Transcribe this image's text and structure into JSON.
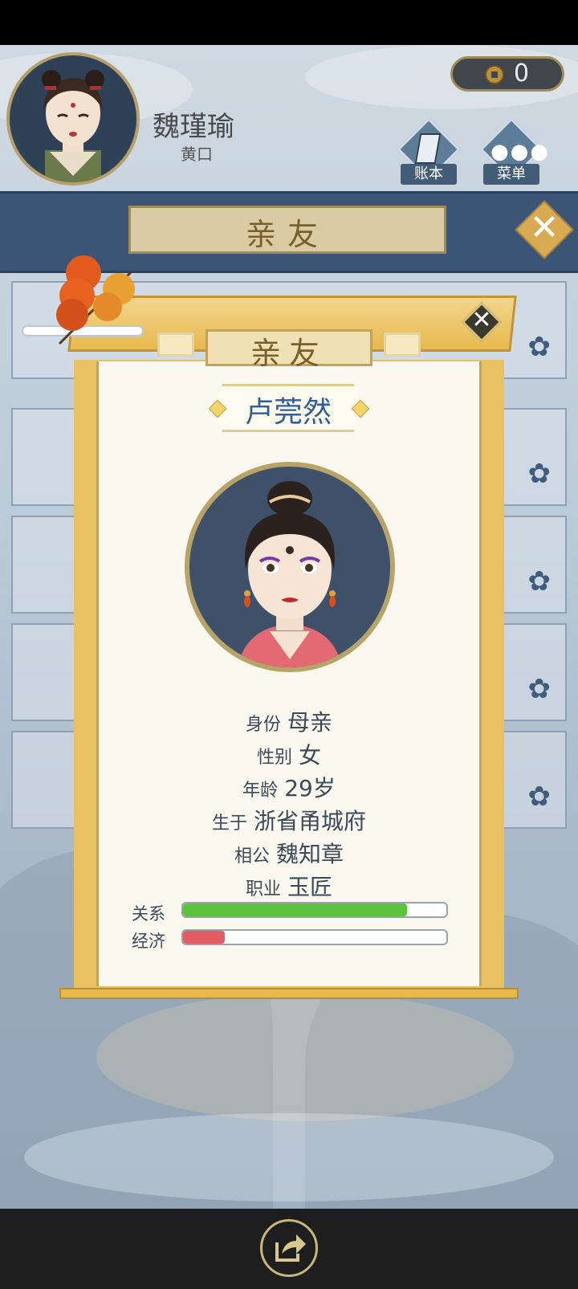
{
  "player": {
    "name": "魏瑾瑜",
    "subtitle": "黄口"
  },
  "currency": {
    "icon": "coin-icon",
    "value": "0"
  },
  "header_buttons": [
    {
      "label": "账本",
      "icon": "book-icon"
    },
    {
      "label": "菜单",
      "icon": "more-dots-icon"
    }
  ],
  "background_panel": {
    "title": "亲友"
  },
  "modal": {
    "title": "亲友",
    "name": "卢莞然",
    "info": [
      {
        "key": "身份",
        "value": "母亲"
      },
      {
        "key": "性别",
        "value": "女"
      },
      {
        "key": "年龄",
        "value": "29岁"
      },
      {
        "key": "生于",
        "value": "浙省甬城府"
      },
      {
        "key": "相公",
        "value": "魏知章"
      },
      {
        "key": "职业",
        "value": "玉匠"
      }
    ],
    "bars": [
      {
        "label": "关系",
        "level": 0.85,
        "color": "#5cc33f"
      },
      {
        "label": "经济",
        "level": 0.16,
        "color": "#e35b63"
      }
    ]
  },
  "colors": {
    "accent_gold": "#d8aa52",
    "navy": "#3c5577",
    "name_blue": "#2f5f99"
  },
  "bottom": {
    "share_icon": "share-icon"
  }
}
